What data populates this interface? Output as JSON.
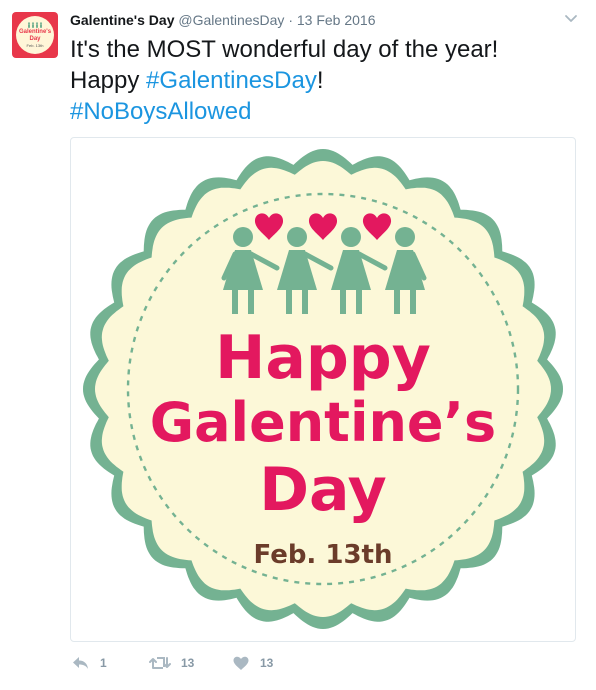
{
  "author": {
    "name": "Galentine's Day",
    "handle": "@GalentinesDay",
    "separator": "·",
    "date": "13 Feb 2016",
    "avatar_text": "Galentine's Day",
    "avatar_subtext": "Feb. 13th"
  },
  "tweet": {
    "line1": "It's the MOST wonderful day of the year!",
    "line2_prefix": "Happy ",
    "hashtag1": "#GalentinesDay",
    "line2_suffix": "!",
    "hashtag2": "#NoBoysAllowed"
  },
  "image": {
    "title_line1": "Happy",
    "title_line2": "Galentine’s",
    "title_line3": "Day",
    "date": "Feb. 13th"
  },
  "actions": {
    "reply_count": "1",
    "retweet_count": "13",
    "like_count": "13"
  },
  "colors": {
    "hashtag": "#1b95e0",
    "pink": "#e3185f",
    "green": "#74b292",
    "cream": "#fcf8d8",
    "brown": "#6b3c2a"
  }
}
